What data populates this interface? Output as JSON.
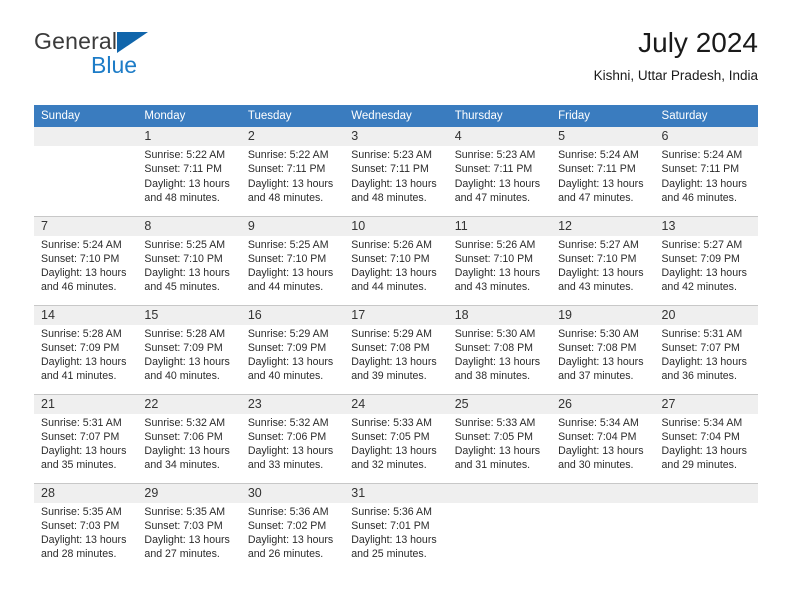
{
  "brand": {
    "name_part1": "General",
    "name_part2": "Blue",
    "triangle_icon": "triangle-icon",
    "accent_blue": "#1d7cc7",
    "logo_dark": "#3b3b3b"
  },
  "header": {
    "title": "July 2024",
    "subtitle": "Kishni, Uttar Pradesh, India"
  },
  "calendar": {
    "header_bg": "#3a7cbf",
    "daynum_bg": "#efefef",
    "weekdays": [
      "Sunday",
      "Monday",
      "Tuesday",
      "Wednesday",
      "Thursday",
      "Friday",
      "Saturday"
    ],
    "labels": {
      "sunrise": "Sunrise:",
      "sunset": "Sunset:",
      "daylight": "Daylight:"
    },
    "weeks": [
      [
        {
          "day": "",
          "empty": true
        },
        {
          "day": "1",
          "sunrise": "Sunrise: 5:22 AM",
          "sunset": "Sunset: 7:11 PM",
          "daylight_1": "Daylight: 13 hours",
          "daylight_2": "and 48 minutes."
        },
        {
          "day": "2",
          "sunrise": "Sunrise: 5:22 AM",
          "sunset": "Sunset: 7:11 PM",
          "daylight_1": "Daylight: 13 hours",
          "daylight_2": "and 48 minutes."
        },
        {
          "day": "3",
          "sunrise": "Sunrise: 5:23 AM",
          "sunset": "Sunset: 7:11 PM",
          "daylight_1": "Daylight: 13 hours",
          "daylight_2": "and 48 minutes."
        },
        {
          "day": "4",
          "sunrise": "Sunrise: 5:23 AM",
          "sunset": "Sunset: 7:11 PM",
          "daylight_1": "Daylight: 13 hours",
          "daylight_2": "and 47 minutes."
        },
        {
          "day": "5",
          "sunrise": "Sunrise: 5:24 AM",
          "sunset": "Sunset: 7:11 PM",
          "daylight_1": "Daylight: 13 hours",
          "daylight_2": "and 47 minutes."
        },
        {
          "day": "6",
          "sunrise": "Sunrise: 5:24 AM",
          "sunset": "Sunset: 7:11 PM",
          "daylight_1": "Daylight: 13 hours",
          "daylight_2": "and 46 minutes."
        }
      ],
      [
        {
          "day": "7",
          "sunrise": "Sunrise: 5:24 AM",
          "sunset": "Sunset: 7:10 PM",
          "daylight_1": "Daylight: 13 hours",
          "daylight_2": "and 46 minutes."
        },
        {
          "day": "8",
          "sunrise": "Sunrise: 5:25 AM",
          "sunset": "Sunset: 7:10 PM",
          "daylight_1": "Daylight: 13 hours",
          "daylight_2": "and 45 minutes."
        },
        {
          "day": "9",
          "sunrise": "Sunrise: 5:25 AM",
          "sunset": "Sunset: 7:10 PM",
          "daylight_1": "Daylight: 13 hours",
          "daylight_2": "and 44 minutes."
        },
        {
          "day": "10",
          "sunrise": "Sunrise: 5:26 AM",
          "sunset": "Sunset: 7:10 PM",
          "daylight_1": "Daylight: 13 hours",
          "daylight_2": "and 44 minutes."
        },
        {
          "day": "11",
          "sunrise": "Sunrise: 5:26 AM",
          "sunset": "Sunset: 7:10 PM",
          "daylight_1": "Daylight: 13 hours",
          "daylight_2": "and 43 minutes."
        },
        {
          "day": "12",
          "sunrise": "Sunrise: 5:27 AM",
          "sunset": "Sunset: 7:10 PM",
          "daylight_1": "Daylight: 13 hours",
          "daylight_2": "and 43 minutes."
        },
        {
          "day": "13",
          "sunrise": "Sunrise: 5:27 AM",
          "sunset": "Sunset: 7:09 PM",
          "daylight_1": "Daylight: 13 hours",
          "daylight_2": "and 42 minutes."
        }
      ],
      [
        {
          "day": "14",
          "sunrise": "Sunrise: 5:28 AM",
          "sunset": "Sunset: 7:09 PM",
          "daylight_1": "Daylight: 13 hours",
          "daylight_2": "and 41 minutes."
        },
        {
          "day": "15",
          "sunrise": "Sunrise: 5:28 AM",
          "sunset": "Sunset: 7:09 PM",
          "daylight_1": "Daylight: 13 hours",
          "daylight_2": "and 40 minutes."
        },
        {
          "day": "16",
          "sunrise": "Sunrise: 5:29 AM",
          "sunset": "Sunset: 7:09 PM",
          "daylight_1": "Daylight: 13 hours",
          "daylight_2": "and 40 minutes."
        },
        {
          "day": "17",
          "sunrise": "Sunrise: 5:29 AM",
          "sunset": "Sunset: 7:08 PM",
          "daylight_1": "Daylight: 13 hours",
          "daylight_2": "and 39 minutes."
        },
        {
          "day": "18",
          "sunrise": "Sunrise: 5:30 AM",
          "sunset": "Sunset: 7:08 PM",
          "daylight_1": "Daylight: 13 hours",
          "daylight_2": "and 38 minutes."
        },
        {
          "day": "19",
          "sunrise": "Sunrise: 5:30 AM",
          "sunset": "Sunset: 7:08 PM",
          "daylight_1": "Daylight: 13 hours",
          "daylight_2": "and 37 minutes."
        },
        {
          "day": "20",
          "sunrise": "Sunrise: 5:31 AM",
          "sunset": "Sunset: 7:07 PM",
          "daylight_1": "Daylight: 13 hours",
          "daylight_2": "and 36 minutes."
        }
      ],
      [
        {
          "day": "21",
          "sunrise": "Sunrise: 5:31 AM",
          "sunset": "Sunset: 7:07 PM",
          "daylight_1": "Daylight: 13 hours",
          "daylight_2": "and 35 minutes."
        },
        {
          "day": "22",
          "sunrise": "Sunrise: 5:32 AM",
          "sunset": "Sunset: 7:06 PM",
          "daylight_1": "Daylight: 13 hours",
          "daylight_2": "and 34 minutes."
        },
        {
          "day": "23",
          "sunrise": "Sunrise: 5:32 AM",
          "sunset": "Sunset: 7:06 PM",
          "daylight_1": "Daylight: 13 hours",
          "daylight_2": "and 33 minutes."
        },
        {
          "day": "24",
          "sunrise": "Sunrise: 5:33 AM",
          "sunset": "Sunset: 7:05 PM",
          "daylight_1": "Daylight: 13 hours",
          "daylight_2": "and 32 minutes."
        },
        {
          "day": "25",
          "sunrise": "Sunrise: 5:33 AM",
          "sunset": "Sunset: 7:05 PM",
          "daylight_1": "Daylight: 13 hours",
          "daylight_2": "and 31 minutes."
        },
        {
          "day": "26",
          "sunrise": "Sunrise: 5:34 AM",
          "sunset": "Sunset: 7:04 PM",
          "daylight_1": "Daylight: 13 hours",
          "daylight_2": "and 30 minutes."
        },
        {
          "day": "27",
          "sunrise": "Sunrise: 5:34 AM",
          "sunset": "Sunset: 7:04 PM",
          "daylight_1": "Daylight: 13 hours",
          "daylight_2": "and 29 minutes."
        }
      ],
      [
        {
          "day": "28",
          "sunrise": "Sunrise: 5:35 AM",
          "sunset": "Sunset: 7:03 PM",
          "daylight_1": "Daylight: 13 hours",
          "daylight_2": "and 28 minutes."
        },
        {
          "day": "29",
          "sunrise": "Sunrise: 5:35 AM",
          "sunset": "Sunset: 7:03 PM",
          "daylight_1": "Daylight: 13 hours",
          "daylight_2": "and 27 minutes."
        },
        {
          "day": "30",
          "sunrise": "Sunrise: 5:36 AM",
          "sunset": "Sunset: 7:02 PM",
          "daylight_1": "Daylight: 13 hours",
          "daylight_2": "and 26 minutes."
        },
        {
          "day": "31",
          "sunrise": "Sunrise: 5:36 AM",
          "sunset": "Sunset: 7:01 PM",
          "daylight_1": "Daylight: 13 hours",
          "daylight_2": "and 25 minutes."
        },
        {
          "day": "",
          "empty": true
        },
        {
          "day": "",
          "empty": true
        },
        {
          "day": "",
          "empty": true
        }
      ]
    ]
  }
}
